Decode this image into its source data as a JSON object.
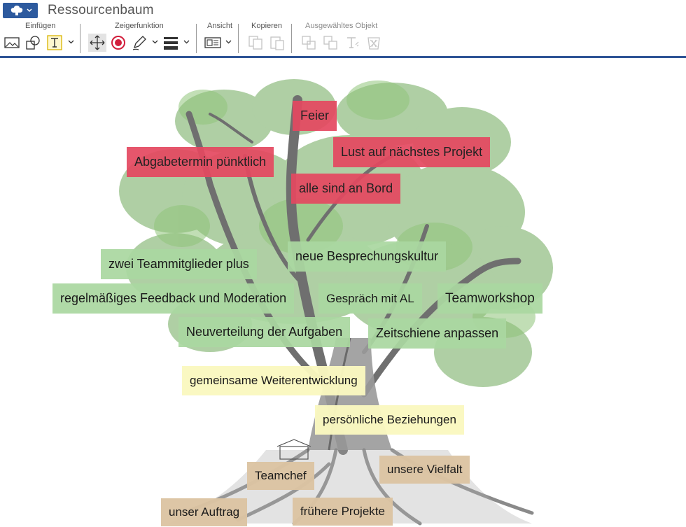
{
  "window": {
    "title": "Ressourcenbaum"
  },
  "ribbon": {
    "app_menu_icon": "tree-icon",
    "groups": {
      "einfuegen": "Einfügen",
      "zeigerfunktion": "Zeigerfunktion",
      "ansicht": "Ansicht",
      "kopieren": "Kopieren",
      "ausgewaehltes_objekt": "Ausgewähltes Objekt"
    },
    "tools": [
      {
        "name": "insert-image-icon"
      },
      {
        "name": "insert-shape-icon"
      },
      {
        "name": "insert-text-icon"
      },
      {
        "name": "move-pointer-icon"
      },
      {
        "name": "laser-pointer-icon"
      },
      {
        "name": "pen-icon"
      },
      {
        "name": "line-style-icon"
      },
      {
        "name": "view-icon"
      },
      {
        "name": "copy-icon"
      },
      {
        "name": "paste-icon"
      },
      {
        "name": "duplicate-icon"
      },
      {
        "name": "arrange-icon"
      },
      {
        "name": "text-format-icon"
      },
      {
        "name": "delete-icon"
      }
    ],
    "accent_color": "#2e5596"
  },
  "notes": {
    "red": [
      "Feier",
      "Lust auf nächstes Projekt",
      "Abgabetermin pünktlich",
      "alle sind an Bord"
    ],
    "green": [
      "zwei Teammitglieder plus",
      "neue Besprechungskultur",
      "regelmäßiges Feedback und Moderation",
      "Gespräch mit AL",
      "Teamworkshop",
      "Neuverteilung der Aufgaben",
      "Zeitschiene anpassen"
    ],
    "yellow": [
      "gemeinsame Weiterentwicklung",
      "persönliche Beziehungen"
    ],
    "tan": [
      "Teamchef",
      "unsere Vielfalt",
      "unser Auftrag",
      "frühere Projekte"
    ]
  },
  "colors": {
    "red_note": "#e44860",
    "green_note": "#aad7a0",
    "yellow_note": "#faf8c0",
    "tan_note": "#dcc4a2"
  }
}
